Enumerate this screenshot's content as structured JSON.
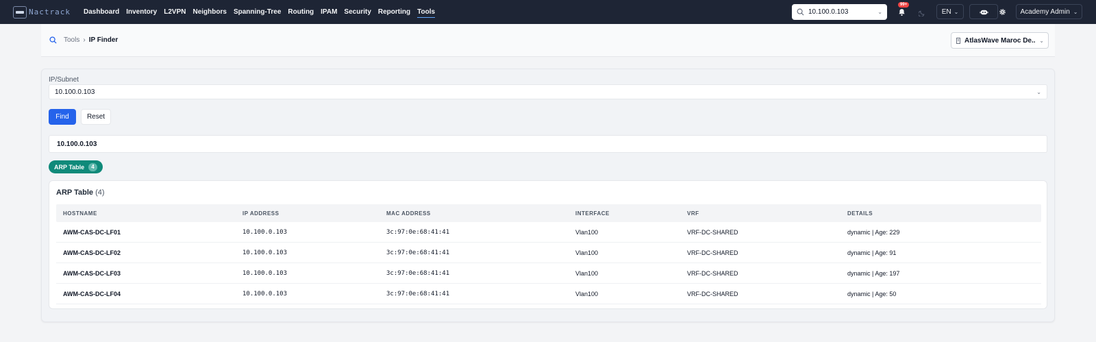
{
  "app": {
    "logo_text": "Nactrack"
  },
  "nav": {
    "items": [
      {
        "label": "Dashboard",
        "active": false
      },
      {
        "label": "Inventory",
        "active": false
      },
      {
        "label": "L2VPN",
        "active": false
      },
      {
        "label": "Neighbors",
        "active": false
      },
      {
        "label": "Spanning-Tree",
        "active": false
      },
      {
        "label": "Routing",
        "active": false
      },
      {
        "label": "IPAM",
        "active": false
      },
      {
        "label": "Security",
        "active": false
      },
      {
        "label": "Reporting",
        "active": false
      },
      {
        "label": "Tools",
        "active": true
      }
    ]
  },
  "header": {
    "search_value": "10.100.0.103",
    "notifications_badge": "99+",
    "language": "EN",
    "user_label": "Academy Admin"
  },
  "breadcrumb": {
    "parent": "Tools",
    "current": "IP Finder"
  },
  "site_selector": {
    "label": "AtlasWave Maroc De..."
  },
  "form": {
    "field_label": "IP/Subnet",
    "field_value": "10.100.0.103",
    "find_label": "Find",
    "reset_label": "Reset"
  },
  "result": {
    "query_ip": "10.100.0.103",
    "chip_label": "ARP Table",
    "chip_count": "4"
  },
  "arp_table": {
    "title": "ARP Table",
    "count_label": "(4)",
    "columns": [
      "Hostname",
      "IP Address",
      "MAC Address",
      "Interface",
      "VRF",
      "Details"
    ],
    "rows": [
      {
        "hostname": "AWM-CAS-DC-LF01",
        "ip": "10.100.0.103",
        "mac": "3c:97:0e:68:41:41",
        "interface": "Vlan100",
        "vrf": "VRF-DC-SHARED",
        "details": "dynamic | Age: 229"
      },
      {
        "hostname": "AWM-CAS-DC-LF02",
        "ip": "10.100.0.103",
        "mac": "3c:97:0e:68:41:41",
        "interface": "Vlan100",
        "vrf": "VRF-DC-SHARED",
        "details": "dynamic | Age: 91"
      },
      {
        "hostname": "AWM-CAS-DC-LF03",
        "ip": "10.100.0.103",
        "mac": "3c:97:0e:68:41:41",
        "interface": "Vlan100",
        "vrf": "VRF-DC-SHARED",
        "details": "dynamic | Age: 197"
      },
      {
        "hostname": "AWM-CAS-DC-LF04",
        "ip": "10.100.0.103",
        "mac": "3c:97:0e:68:41:41",
        "interface": "Vlan100",
        "vrf": "VRF-DC-SHARED",
        "details": "dynamic | Age: 50"
      }
    ]
  },
  "colors": {
    "topbar": "#1e2535",
    "primary": "#2563eb",
    "chip": "#0f8a7a",
    "badge": "#ef4444"
  }
}
